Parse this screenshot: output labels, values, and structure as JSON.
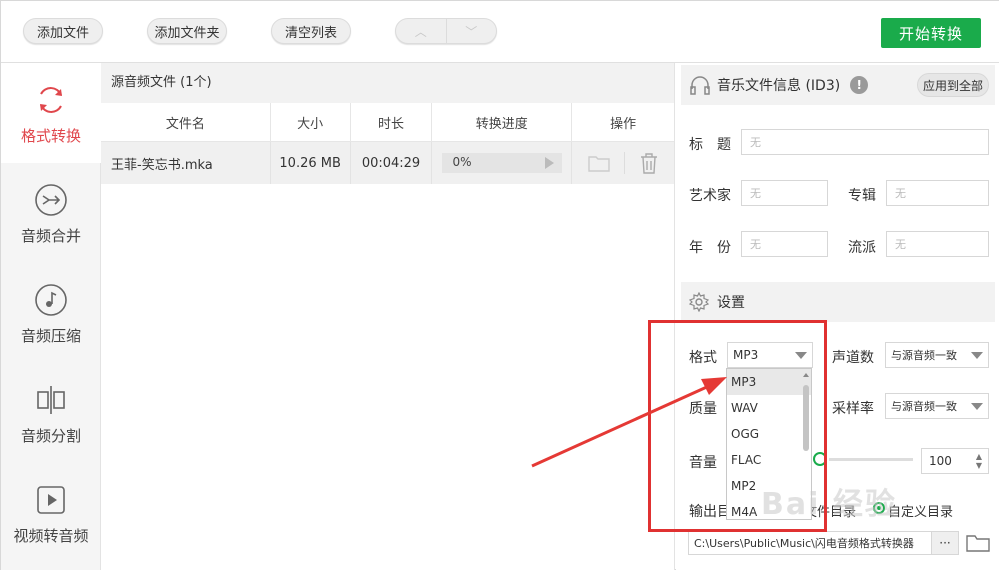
{
  "toolbar": {
    "add_file": "添加文件",
    "add_folder": "添加文件夹",
    "clear_list": "清空列表",
    "start": "开始转换",
    "start_color": "#1aab4b"
  },
  "sidebar": {
    "items": [
      {
        "label": "格式转换",
        "icon": "refresh-icon"
      },
      {
        "label": "音频合并",
        "icon": "merge-icon"
      },
      {
        "label": "音频压缩",
        "icon": "music-note-icon"
      },
      {
        "label": "音频分割",
        "icon": "split-icon"
      },
      {
        "label": "视频转音频",
        "icon": "play-icon"
      }
    ],
    "active_color": "#e0474c"
  },
  "file_list": {
    "title": "源音频文件 (1个)",
    "columns": [
      "文件名",
      "大小",
      "时长",
      "转换进度",
      "操作"
    ],
    "rows": [
      {
        "name": "王菲-笑忘书.mka",
        "size": "10.26 MB",
        "duration": "00:04:29",
        "progress": "0%"
      }
    ]
  },
  "id3": {
    "title": "音乐文件信息 (ID3)",
    "warn": "!",
    "apply_all": "应用到全部",
    "title_label": "标　题",
    "artist_label": "艺术家",
    "album_label": "专辑",
    "year_label": "年　份",
    "genre_label": "流派",
    "placeholder": "无"
  },
  "settings": {
    "title": "设置",
    "format_label": "格式",
    "format_value": "MP3",
    "format_options": [
      "MP3",
      "WAV",
      "OGG",
      "FLAC",
      "MP2",
      "M4A"
    ],
    "channels_label": "声道数",
    "channels_value": "与源音频一致",
    "quality_label": "质量",
    "samplerate_label": "采样率",
    "samplerate_value": "与源音频一致",
    "volume_label": "音量",
    "volume_value": "100",
    "output_label": "输出目录",
    "output_source": "原文件目录",
    "output_custom": "自定义目录",
    "output_path": "C:\\Users\\Public\\Music\\闪电音频格式转换器",
    "browse": "···"
  },
  "watermark": "Bai 经验"
}
